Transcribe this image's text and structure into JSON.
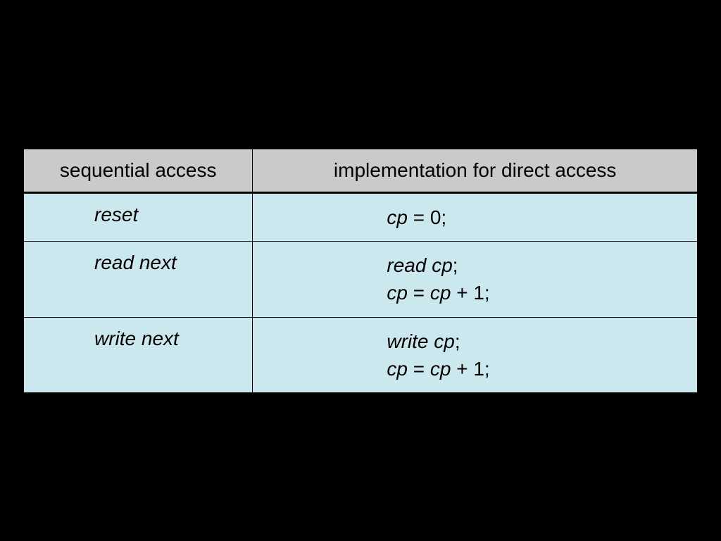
{
  "table": {
    "headers": {
      "col1": "sequential access",
      "col2": "implementation for direct access"
    },
    "rows": [
      {
        "seq": "reset",
        "impl_line1_var": "cp",
        "impl_line1_rest": " = 0;",
        "has_line2": false
      },
      {
        "seq": "read next",
        "impl_line1_pre": "read ",
        "impl_line1_var": "cp",
        "impl_line1_post": ";",
        "impl_line2_var1": "cp",
        "impl_line2_mid": " = ",
        "impl_line2_var2": "cp",
        "impl_line2_end": " + 1;",
        "has_line2": true
      },
      {
        "seq": "write next",
        "impl_line1_pre": "write ",
        "impl_line1_var": "cp",
        "impl_line1_post": ";",
        "impl_line2_var1": "cp",
        "impl_line2_mid": " = ",
        "impl_line2_var2": "cp",
        "impl_line2_end": " + 1;",
        "has_line2": true
      }
    ]
  }
}
